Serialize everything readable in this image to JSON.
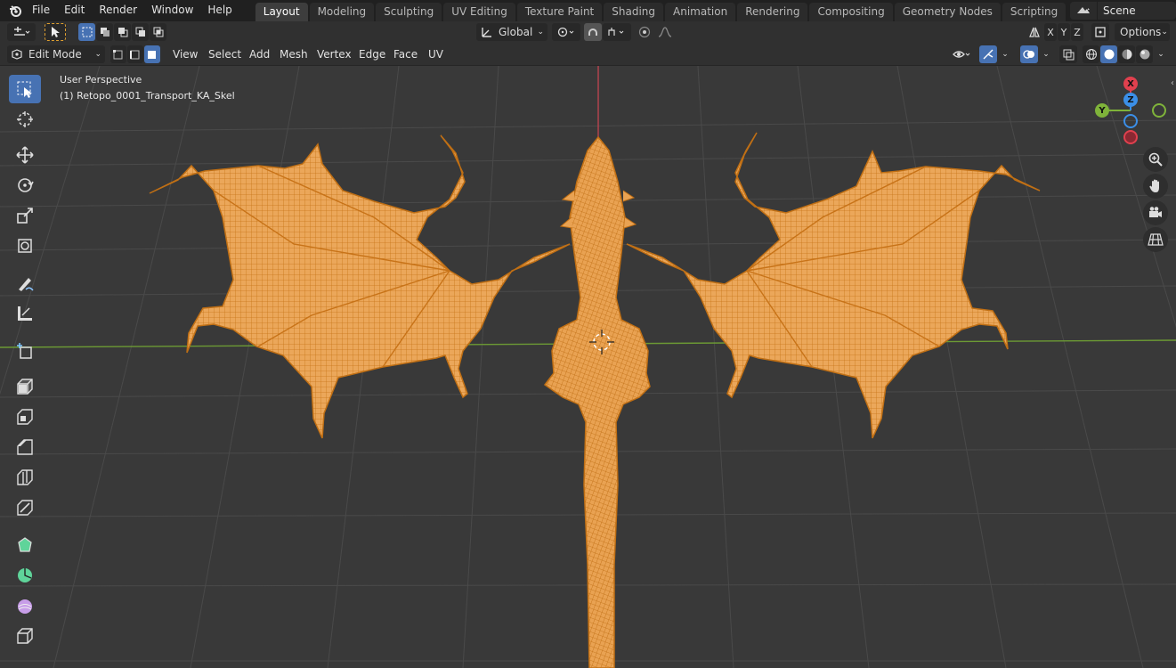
{
  "menubar": {
    "items": [
      "File",
      "Edit",
      "Render",
      "Window",
      "Help"
    ]
  },
  "workspaces": [
    {
      "label": "Layout",
      "active": true
    },
    {
      "label": "Modeling"
    },
    {
      "label": "Sculpting"
    },
    {
      "label": "UV Editing"
    },
    {
      "label": "Texture Paint"
    },
    {
      "label": "Shading"
    },
    {
      "label": "Animation"
    },
    {
      "label": "Rendering"
    },
    {
      "label": "Compositing"
    },
    {
      "label": "Geometry Nodes"
    },
    {
      "label": "Scripting"
    }
  ],
  "scene": {
    "name": "Scene"
  },
  "toolbar": {
    "transform_orientation": "Global",
    "axis_x": "X",
    "axis_y": "Y",
    "axis_z": "Z",
    "options_label": "Options"
  },
  "header": {
    "mode": "Edit Mode",
    "menus": [
      "View",
      "Select",
      "Add",
      "Mesh",
      "Vertex",
      "Edge",
      "Face",
      "UV"
    ]
  },
  "viewport": {
    "perspective_label": "User Perspective",
    "object_label": "(1) Retopo_0001_Transport_KA_Skel"
  },
  "gizmo": {
    "x": "X",
    "y": "Y",
    "z": "Z"
  },
  "colors": {
    "accent": "#4772b3",
    "mesh": "#e9a14a",
    "mesh_wire": "#c77417",
    "axis_x": "#e0404e",
    "axis_y": "#7fb33a",
    "axis_z": "#3b8fe8"
  },
  "tools": [
    "select-box-icon",
    "cursor-icon",
    "move-icon",
    "rotate-icon",
    "scale-icon",
    "transform-icon",
    "annotate-icon",
    "measure-icon",
    "add-cube-icon",
    "extrude-icon",
    "inset-icon",
    "bevel-icon",
    "loop-cut-icon",
    "knife-icon",
    "poly-build-icon",
    "spin-icon",
    "smooth-icon",
    "shrink-fatten-icon"
  ]
}
